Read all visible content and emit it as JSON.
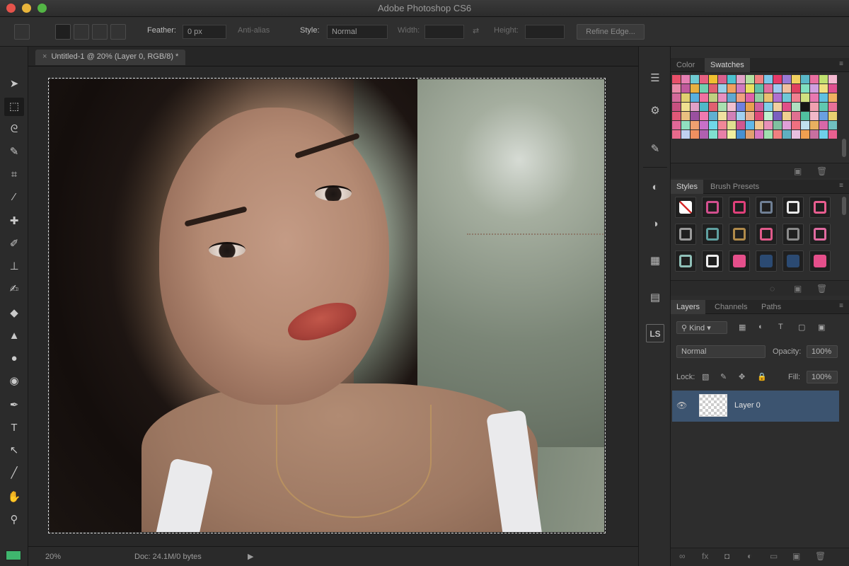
{
  "window": {
    "title": "Adobe Photoshop CS6"
  },
  "options": {
    "feather_label": "Feather:",
    "feather_value": "0 px",
    "antialias_label": "Anti-alias",
    "style_label": "Style:",
    "style_value": "Normal",
    "width_label": "Width:",
    "height_label": "Height:",
    "refine_label": "Refine Edge..."
  },
  "document": {
    "tab_label": "Untitled-1 @ 20% (Layer 0, RGB/8) *",
    "zoom": "20%",
    "doc_info": "Doc: 24.1M/0 bytes"
  },
  "swatches": {
    "tabs": [
      "Color",
      "Swatches"
    ],
    "colors": [
      "#e8506a",
      "#e57fb2",
      "#6fcad1",
      "#e66080",
      "#f0c030",
      "#d9608e",
      "#4dc2d0",
      "#e2a3c8",
      "#b2e0a0",
      "#f08080",
      "#7cc6e8",
      "#e53a6a",
      "#9a7bd6",
      "#f0d060",
      "#5ab8c8",
      "#e86fa0",
      "#c0e070",
      "#f4b8d0",
      "#e98aa8",
      "#c05a9c",
      "#e8b040",
      "#70d0b0",
      "#e06070",
      "#9ad0e8",
      "#f0a060",
      "#d07ac0",
      "#e8e060",
      "#60c0a8",
      "#e070a0",
      "#a0c8f0",
      "#f0c0a0",
      "#e04060",
      "#80e0c0",
      "#d0a0e0",
      "#f0e080",
      "#e05090",
      "#d36a9a",
      "#e0d070",
      "#58b0e0",
      "#f070a0",
      "#c0d080",
      "#e890c0",
      "#60a8d0",
      "#f0a080",
      "#e060a8",
      "#90d0a0",
      "#e8c070",
      "#b070d0",
      "#70c8d8",
      "#f08090",
      "#d0e080",
      "#e878b0",
      "#60c0e0",
      "#f0b060",
      "#c85080",
      "#f0e090",
      "#e0a0c8",
      "#50b8c8",
      "#e06070",
      "#a8e0b0",
      "#f0c0d0",
      "#7080e0",
      "#e8a050",
      "#d060a0",
      "#80d0e8",
      "#f0d0a0",
      "#e05088",
      "#b0e0c0",
      "#161616",
      "#f0a0b0",
      "#60c8b0",
      "#e87098",
      "#e05878",
      "#e8c080",
      "#9a50a0",
      "#f07ab0",
      "#60b0d0",
      "#f0e0a0",
      "#d080b8",
      "#a0d0f0",
      "#e8b090",
      "#e04878",
      "#c0f0d0",
      "#7a60c0",
      "#f0d090",
      "#e07090",
      "#50c0a0",
      "#f0b8c8",
      "#6aa0e0",
      "#e8d070",
      "#e06898",
      "#90e0c0",
      "#f0a070",
      "#c870c8",
      "#70d8e8",
      "#f08898",
      "#e0e090",
      "#d05890",
      "#60b8e8",
      "#f0c890",
      "#e890b8",
      "#80c0a0",
      "#e0a0d8",
      "#f07080",
      "#c0e0f0",
      "#e8b060",
      "#d868a8",
      "#70c0c0",
      "#e86a8c",
      "#c0d0f0",
      "#f09060",
      "#b060b0",
      "#80e0d0",
      "#e880a8",
      "#f0f0a0",
      "#4890d0",
      "#e0a070",
      "#d878c0",
      "#a0e0b0",
      "#f08080",
      "#60b0c0",
      "#e8c0e0",
      "#f0a050",
      "#c870a0",
      "#70d0e8",
      "#e86090"
    ]
  },
  "styles": {
    "tabs": [
      "Styles",
      "Brush Presets"
    ],
    "cells": [
      {
        "kind": "none",
        "color": "#ffffff"
      },
      {
        "kind": "outline",
        "color": "#d24f8e"
      },
      {
        "kind": "outline",
        "color": "#e0407a"
      },
      {
        "kind": "outline",
        "color": "#6f7f94"
      },
      {
        "kind": "outline",
        "color": "#e8e8e8"
      },
      {
        "kind": "outline",
        "color": "#e85d8f"
      },
      {
        "kind": "outline",
        "color": "#9a9a9a"
      },
      {
        "kind": "outline",
        "color": "#5fa0a0"
      },
      {
        "kind": "outline",
        "color": "#b08a4a"
      },
      {
        "kind": "outline",
        "color": "#e05a8a"
      },
      {
        "kind": "outline",
        "color": "#8a8a8a"
      },
      {
        "kind": "outline",
        "color": "#e06aa0"
      },
      {
        "kind": "outline",
        "color": "#90c0b8"
      },
      {
        "kind": "outline",
        "color": "#eeeeee"
      },
      {
        "kind": "fill",
        "color": "#e54f8b"
      },
      {
        "kind": "dark",
        "color": "#2b4a72"
      },
      {
        "kind": "dark",
        "color": "#2b4a72"
      },
      {
        "kind": "fill",
        "color": "#e54f8b"
      }
    ]
  },
  "layers": {
    "tabs": [
      "Layers",
      "Channels",
      "Paths"
    ],
    "kind_filter": "Kind",
    "blend_mode": "Normal",
    "opacity_label": "Opacity:",
    "opacity_value": "100%",
    "lock_label": "Lock:",
    "fill_label": "Fill:",
    "fill_value": "100%",
    "items": [
      {
        "name": "Layer 0",
        "selected": true
      }
    ]
  },
  "tools": [
    "move-tool",
    "marquee-tool",
    "lasso-tool",
    "quick-select-tool",
    "crop-tool",
    "eyedropper-tool",
    "healing-brush-tool",
    "brush-tool",
    "clone-stamp-tool",
    "history-brush-tool",
    "eraser-tool",
    "gradient-tool",
    "blur-tool",
    "dodge-tool",
    "pen-tool",
    "type-tool",
    "path-select-tool",
    "shape-tool",
    "hand-tool",
    "zoom-tool"
  ],
  "dock": {
    "ls_label": "LS"
  }
}
